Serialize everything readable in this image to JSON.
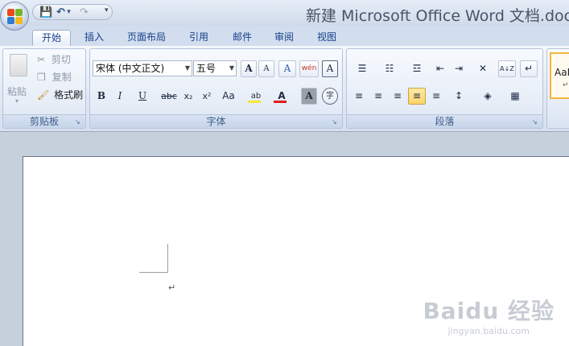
{
  "window": {
    "title": "新建 Microsoft Office Word 文档.doc",
    "office_button": "office-logo",
    "qat": {
      "save": "💾",
      "undo": "↶",
      "undo_dd": "▾",
      "redo": "↷",
      "customize": "▾"
    }
  },
  "tabs": [
    "开始",
    "插入",
    "页面布局",
    "引用",
    "邮件",
    "审阅",
    "视图"
  ],
  "clipboard": {
    "label": "剪贴板",
    "paste": "粘贴",
    "cut": "剪切",
    "copy": "复制",
    "format_painter": "格式刷"
  },
  "font": {
    "label": "字体",
    "font_name": "宋体 (中文正文)",
    "font_size": "五号",
    "grow": "A",
    "shrink": "A",
    "clear_format": "A",
    "phonetic": "wén",
    "char_border": "A",
    "bold": "B",
    "italic": "I",
    "underline": "U",
    "strikethrough": "abc",
    "subscript": "x₂",
    "superscript": "x²",
    "change_case": "Aa",
    "highlight": "ab",
    "font_color": "A",
    "char_shading": "A",
    "enclose": "字"
  },
  "paragraph": {
    "label": "段落",
    "bullets": "☰",
    "numbering": "☷",
    "multilevel": "☲",
    "decrease_indent": "⇤",
    "increase_indent": "⇥",
    "chinese_layout": "✕",
    "sort": "A↓Z",
    "show_marks": "↵",
    "align_left": "≡",
    "center": "≡",
    "align_right": "≡",
    "justify": "≡",
    "distribute": "≡",
    "line_spacing": "↕",
    "shading": "◈",
    "borders": "▦"
  },
  "styles": {
    "preview": "AaB",
    "mark": "↵"
  },
  "document": {
    "paragraph_mark": "↵"
  },
  "watermark": {
    "logo": "Baidu 经验",
    "url": "jingyan.baidu.com"
  },
  "colors": {
    "highlight": "#f5e63a",
    "font_color": "#e31b1b",
    "justify_active": "#fbd46b"
  }
}
